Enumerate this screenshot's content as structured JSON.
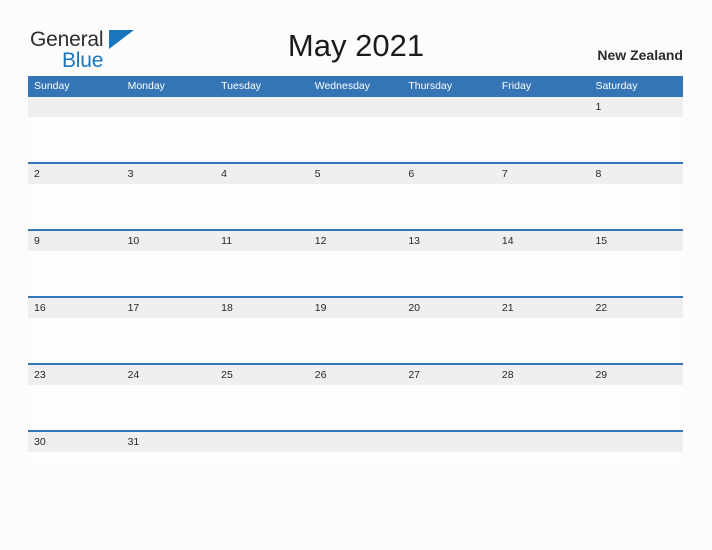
{
  "brand": {
    "word1": "General",
    "word2": "Blue",
    "flag_icon": "blue-triangle-flag-icon",
    "color_dark": "#2e2e2e",
    "color_blue": "#1a76bc"
  },
  "header": {
    "title": "May 2021",
    "location": "New Zealand"
  },
  "calendar": {
    "header_color": "#3575b5",
    "band_color": "#efefef",
    "weekdays": [
      "Sunday",
      "Monday",
      "Tuesday",
      "Wednesday",
      "Thursday",
      "Friday",
      "Saturday"
    ],
    "weeks": [
      [
        "",
        "",
        "",
        "",
        "",
        "",
        "1"
      ],
      [
        "2",
        "3",
        "4",
        "5",
        "6",
        "7",
        "8"
      ],
      [
        "9",
        "10",
        "11",
        "12",
        "13",
        "14",
        "15"
      ],
      [
        "16",
        "17",
        "18",
        "19",
        "20",
        "21",
        "22"
      ],
      [
        "23",
        "24",
        "25",
        "26",
        "27",
        "28",
        "29"
      ],
      [
        "30",
        "31",
        "",
        "",
        "",
        "",
        ""
      ]
    ]
  }
}
